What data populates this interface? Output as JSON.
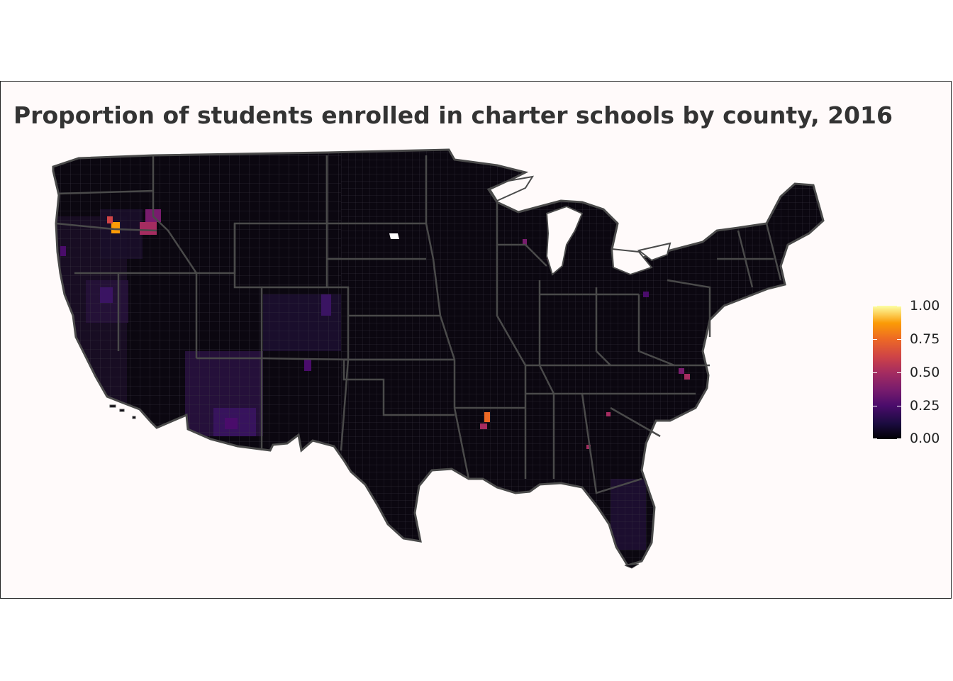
{
  "title": "Proportion of students enrolled in charter schools by county, 2016",
  "legend": {
    "ticks": [
      {
        "value": 1.0,
        "label": "1.00"
      },
      {
        "value": 0.75,
        "label": "0.75"
      },
      {
        "value": 0.5,
        "label": "0.50"
      },
      {
        "value": 0.25,
        "label": "0.25"
      },
      {
        "value": 0.0,
        "label": "0.00"
      }
    ],
    "range": [
      0,
      1
    ],
    "palette": [
      "#000004",
      "#1c0c41",
      "#4a0c6b",
      "#781c6d",
      "#a52c60",
      "#cf4446",
      "#ed6925",
      "#fb9b06",
      "#fcffa4"
    ]
  },
  "map": {
    "region": "Contiguous United States",
    "unit": "county",
    "border_color": "#4a4a4a",
    "base_fill": "#0b0710",
    "background": "#fffafa"
  }
}
